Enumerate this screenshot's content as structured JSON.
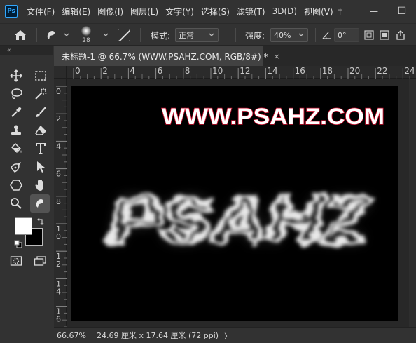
{
  "menubar": {
    "items": [
      "文件(F)",
      "编辑(E)",
      "图像(I)",
      "图层(L)",
      "文字(Y)",
      "选择(S)",
      "滤镜(T)",
      "3D(D)",
      "视图(V)"
    ],
    "overflow": "†",
    "minimize": "—",
    "maximize": "☐"
  },
  "options": {
    "brush_size": "28",
    "mode_label": "模式:",
    "mode_value": "正常",
    "strength_label": "强度:",
    "strength_value": "40%",
    "angle_value": "0°"
  },
  "toolbar": {
    "collapse": "«",
    "tools": [
      "move-tool",
      "marquee-tool",
      "lasso-tool",
      "magic-wand-tool",
      "eyedropper-tool",
      "brush-tool",
      "stamp-tool",
      "eraser-tool",
      "bucket-tool",
      "type-tool",
      "pen-tool",
      "path-select-tool",
      "shape-tool",
      "hand-tool",
      "zoom-tool",
      "smudge-tool"
    ],
    "active_tool": "smudge-tool",
    "foreground_color": "#ffffff",
    "background_color": "#000000"
  },
  "document": {
    "tab_title": "未标题-1 @ 66.7% (WWW.PSAHZ.COM, RGB/8#) *",
    "close_glyph": "×",
    "hruler_labels": [
      "0",
      "2",
      "4",
      "6",
      "8",
      "10",
      "12",
      "14",
      "16",
      "18",
      "20",
      "22",
      "24"
    ],
    "vruler_labels": [
      "0",
      "2",
      "4",
      "6",
      "8",
      "10",
      "12",
      "14",
      "16"
    ],
    "watermark_text": "WWW.PSAHZ.COM",
    "smoke_text": "PSAHZ",
    "canvas_color": "#000000"
  },
  "status": {
    "zoom": "66.67%",
    "doc_info": "24.69 厘米 x 17.64 厘米 (72 ppi)",
    "arrow": "〉"
  }
}
